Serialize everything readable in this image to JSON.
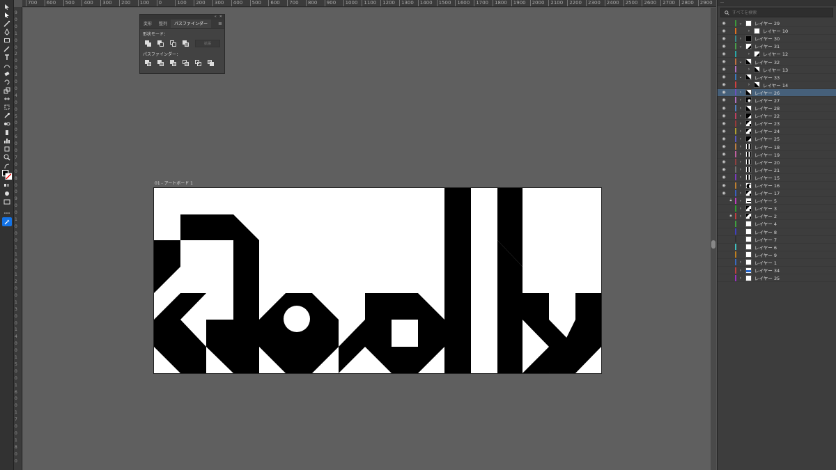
{
  "ruler_top": [
    "700",
    "600",
    "500",
    "400",
    "300",
    "200",
    "100",
    "0",
    "100",
    "200",
    "300",
    "400",
    "500",
    "600",
    "700",
    "800",
    "900",
    "1000",
    "1100",
    "1200",
    "1300",
    "1400",
    "1500",
    "1600",
    "1700",
    "1800",
    "1900",
    "2000",
    "2100",
    "2200",
    "2300",
    "2400",
    "2500",
    "2600",
    "2700",
    "2800",
    "2900"
  ],
  "ruler_left": [
    "9",
    "0",
    "0",
    "1",
    "0",
    "0",
    "2",
    "0",
    "0",
    "3",
    "0",
    "0",
    "4",
    "0",
    "0",
    "5",
    "0",
    "0",
    "6",
    "0",
    "0",
    "7",
    "0",
    "0",
    "8",
    "0",
    "0",
    "9",
    "0",
    "0",
    "1",
    "0",
    "0",
    "0",
    "1",
    "1",
    "0",
    "0",
    "1",
    "2",
    "0",
    "0",
    "1",
    "3",
    "0",
    "0",
    "1",
    "4",
    "0",
    "0",
    "1",
    "5",
    "0",
    "0",
    "1",
    "6",
    "0",
    "0",
    "1",
    "7",
    "0",
    "0",
    "1",
    "8",
    "0",
    "0"
  ],
  "artboard_label": "01 - アートボード 1",
  "pathfinder": {
    "tabs": [
      "変形",
      "整列",
      "パスファインダー"
    ],
    "active_tab": 2,
    "shape_modes_label": "形状モード：",
    "expand_label": "拡張",
    "pathfinders_label": "パスファインダー："
  },
  "layers": {
    "search_placeholder": "すべてを検索",
    "rows": [
      {
        "name": "レイヤー 29",
        "color": "#3d9a3d",
        "indent": 0,
        "open": true,
        "thumb": "white",
        "eye": true
      },
      {
        "name": "レイヤー 10",
        "color": "#e07020",
        "indent": 1,
        "open": false,
        "thumb": "white",
        "eye": true
      },
      {
        "name": "レイヤー 30",
        "color": "#3a8a8a",
        "indent": 0,
        "open": false,
        "thumb": "black",
        "eye": true
      },
      {
        "name": "レイヤー 31",
        "color": "#4aa04a",
        "indent": 0,
        "open": true,
        "thumb": "diag",
        "eye": true
      },
      {
        "name": "レイヤー 12",
        "color": "#2aa8a8",
        "indent": 1,
        "open": false,
        "thumb": "diag",
        "eye": true
      },
      {
        "name": "レイヤー 32",
        "color": "#c07040",
        "indent": 0,
        "open": true,
        "thumb": "tri",
        "eye": true
      },
      {
        "name": "レイヤー 13",
        "color": "#b070c0",
        "indent": 1,
        "open": false,
        "thumb": "tri",
        "eye": true
      },
      {
        "name": "レイヤー 33",
        "color": "#3a7ac0",
        "indent": 0,
        "open": true,
        "thumb": "tri",
        "eye": true
      },
      {
        "name": "レイヤー 14",
        "color": "#d04040",
        "indent": 1,
        "open": false,
        "thumb": "tri",
        "eye": true
      },
      {
        "name": "レイヤー 26",
        "color": "#6a50c0",
        "indent": 0,
        "open": false,
        "thumb": "tri",
        "eye": true,
        "selected": true
      },
      {
        "name": "レイヤー 27",
        "color": "#b070c0",
        "indent": 0,
        "open": false,
        "thumb": "dot",
        "eye": true
      },
      {
        "name": "レイヤー 28",
        "color": "#5080c0",
        "indent": 0,
        "open": false,
        "thumb": "tri",
        "eye": true
      },
      {
        "name": "レイヤー 22",
        "color": "#c04060",
        "indent": 0,
        "open": false,
        "thumb": "tri2",
        "eye": true
      },
      {
        "name": "レイヤー 23",
        "color": "#9a3a3a",
        "indent": 0,
        "open": false,
        "thumb": "mix",
        "eye": true
      },
      {
        "name": "レイヤー 24",
        "color": "#b0a030",
        "indent": 0,
        "open": false,
        "thumb": "mix",
        "eye": true
      },
      {
        "name": "レイヤー 25",
        "color": "#5a5ac0",
        "indent": 0,
        "open": false,
        "thumb": "tri2",
        "eye": true
      },
      {
        "name": "レイヤー 18",
        "color": "#c08040",
        "indent": 0,
        "open": false,
        "thumb": "bars",
        "eye": true
      },
      {
        "name": "レイヤー 19",
        "color": "#c060a0",
        "indent": 0,
        "open": false,
        "thumb": "bars",
        "eye": true
      },
      {
        "name": "レイヤー 20",
        "color": "#904040",
        "indent": 0,
        "open": false,
        "thumb": "bars",
        "eye": true
      },
      {
        "name": "レイヤー 21",
        "color": "#707070",
        "indent": 0,
        "open": false,
        "thumb": "bars",
        "eye": true
      },
      {
        "name": "レイヤー 15",
        "color": "#7a3ac0",
        "indent": 0,
        "open": false,
        "thumb": "bars",
        "eye": true
      },
      {
        "name": "レイヤー 16",
        "color": "#c08030",
        "indent": 0,
        "open": false,
        "thumb": "moon",
        "eye": true
      },
      {
        "name": "レイヤー 17",
        "color": "#3a60c0",
        "indent": 0,
        "open": false,
        "thumb": "mix",
        "eye": true
      },
      {
        "name": "レイヤー 5",
        "color": "#c040c0",
        "indent": 0,
        "open": false,
        "thumb": "line",
        "eye": false,
        "lock": true
      },
      {
        "name": "レイヤー 3",
        "color": "#30a030",
        "indent": 0,
        "open": false,
        "thumb": "mix",
        "eye": false
      },
      {
        "name": "レイヤー 2",
        "color": "#c04040",
        "indent": 0,
        "open": false,
        "thumb": "mix",
        "eye": false,
        "lock": true
      },
      {
        "name": "レイヤー 4",
        "color": "#40a040",
        "indent": 0,
        "open": false,
        "thumb": "white",
        "eye": false,
        "nochev": true
      },
      {
        "name": "レイヤー 8",
        "color": "#4040c0",
        "indent": 0,
        "open": false,
        "thumb": "white",
        "eye": false,
        "nochev": true
      },
      {
        "name": "レイヤー 7",
        "color": "#303030",
        "indent": 0,
        "open": false,
        "thumb": "white",
        "eye": false,
        "nochev": true
      },
      {
        "name": "レイヤー 6",
        "color": "#40c0c0",
        "indent": 0,
        "open": false,
        "thumb": "white",
        "eye": false,
        "nochev": true
      },
      {
        "name": "レイヤー 9",
        "color": "#c08020",
        "indent": 0,
        "open": false,
        "thumb": "white",
        "eye": false,
        "nochev": true
      },
      {
        "name": "レイヤー 1",
        "color": "#3a6ac0",
        "indent": 0,
        "open": false,
        "thumb": "white",
        "eye": false
      },
      {
        "name": "レイヤー 34",
        "color": "#c04040",
        "indent": 0,
        "open": false,
        "thumb": "blue",
        "eye": false
      },
      {
        "name": "レイヤー 35",
        "color": "#9a30c0",
        "indent": 0,
        "open": false,
        "thumb": "white",
        "eye": false
      }
    ]
  },
  "colors": {
    "accent": "#1473e6",
    "selected_row": "#46607a"
  }
}
